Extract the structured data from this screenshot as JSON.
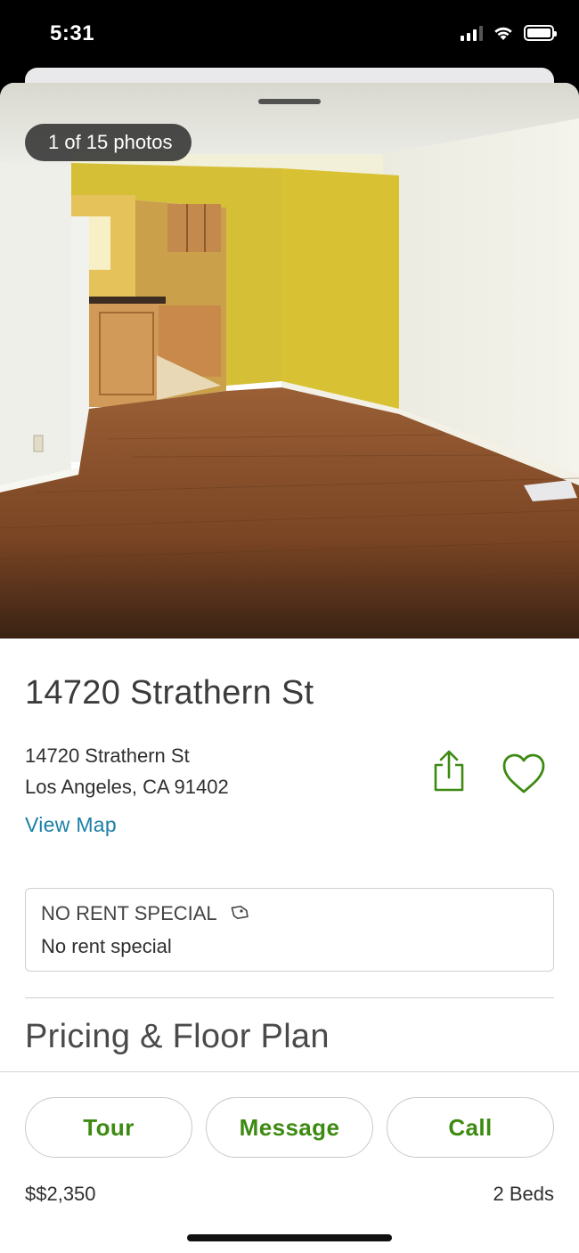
{
  "status_bar": {
    "time": "5:31"
  },
  "photo": {
    "counter": "1 of 15 photos"
  },
  "listing": {
    "title": "14720 Strathern St",
    "address_line1": "14720 Strathern St",
    "address_line2": "Los Angeles, CA 91402",
    "view_map": "View Map"
  },
  "rent_special": {
    "heading": "NO RENT SPECIAL",
    "text": "No rent special"
  },
  "pricing": {
    "section_title": "Pricing & Floor Plan"
  },
  "actions": {
    "tour": "Tour",
    "message": "Message",
    "call": "Call"
  },
  "summary": {
    "price": "$$2,350",
    "beds": "2 Beds"
  },
  "colors": {
    "accent_green": "#3d8a12",
    "link_blue": "#1a7fa6"
  }
}
